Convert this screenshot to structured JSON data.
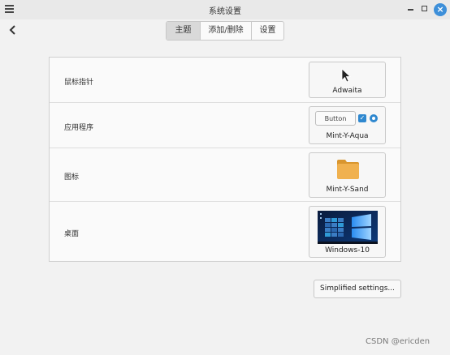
{
  "window": {
    "title": "系统设置"
  },
  "tabs": [
    {
      "label": "主题",
      "active": true
    },
    {
      "label": "添加/删除",
      "active": false
    },
    {
      "label": "设置",
      "active": false
    }
  ],
  "settings": {
    "rows": [
      {
        "label": "鼠标指针",
        "value": "Adwaita",
        "preview_icon": "cursor-arrow-icon"
      },
      {
        "label": "应用程序",
        "value": "Mint-Y-Aqua",
        "preview_button": "Button",
        "preview_icon": "checkbox-radio-preview"
      },
      {
        "label": "图标",
        "value": "Mint-Y-Sand",
        "preview_icon": "folder-icon"
      },
      {
        "label": "桌面",
        "value": "Windows-10",
        "preview_icon": "desktop-wallpaper-thumbnail"
      }
    ]
  },
  "buttons": {
    "simplified": "Simplified settings..."
  },
  "watermark": "CSDN @ericden",
  "colors": {
    "accent": "#3d8fd9",
    "folder": "#f0b14f",
    "background": "#f2f2f2"
  }
}
